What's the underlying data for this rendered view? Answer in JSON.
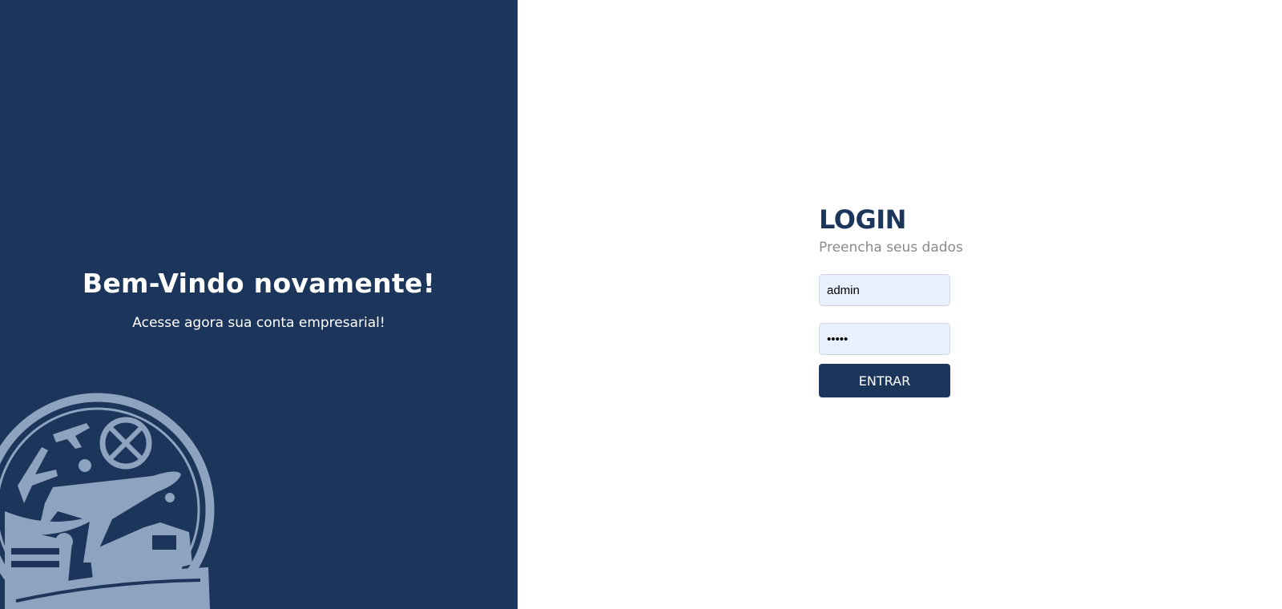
{
  "welcome": {
    "title": "Bem-Vindo novamente!",
    "subtitle": "Acesse agora sua conta empresarial!"
  },
  "emblem": {
    "icon": "logistics-emblem-icon",
    "color": "#8ea3bf"
  },
  "login": {
    "title": "LOGIN",
    "subtitle": "Preencha seus dados",
    "username_value": "admin",
    "password_value": "admin",
    "submit_label": "ENTRAR"
  },
  "colors": {
    "brand": "#1c355a",
    "input_bg": "#e8f0fe",
    "muted_text": "#8a8a8a"
  }
}
